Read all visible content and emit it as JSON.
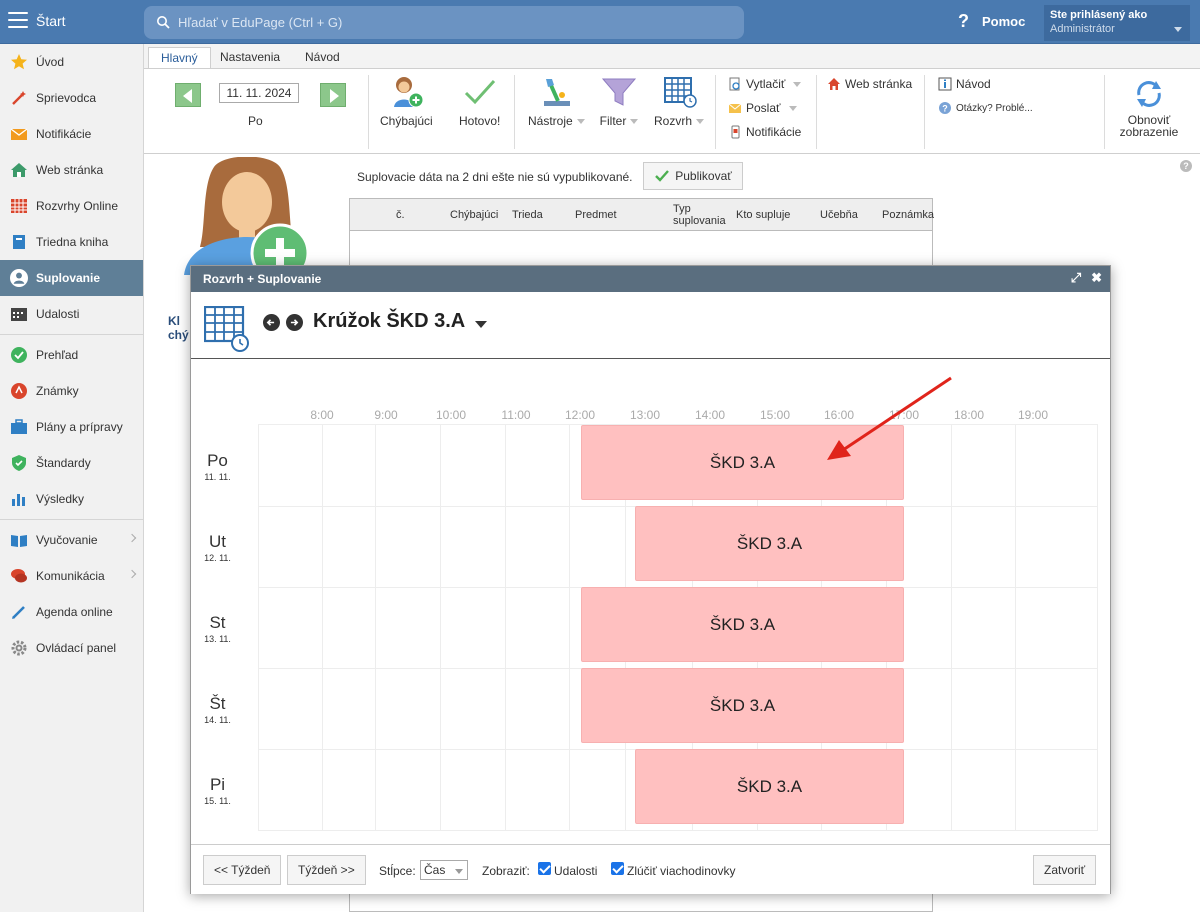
{
  "topbar": {
    "start_label": "Štart",
    "search_placeholder": "Hľadať v EduPage (Ctrl + G)",
    "help_label": "Pomoc",
    "user_line1": "Ste prihlásený ako",
    "user_line2": "Administrátor"
  },
  "sidebar": {
    "items": [
      {
        "label": "Úvod",
        "icon": "star-icon"
      },
      {
        "label": "Sprievodca",
        "icon": "magic-wand-icon"
      },
      {
        "label": "Notifikácie",
        "icon": "envelope-icon"
      },
      {
        "label": "Web stránka",
        "icon": "house-icon"
      },
      {
        "label": "Rozvrhy Online",
        "icon": "calendar-grid-icon"
      },
      {
        "label": "Triedna kniha",
        "icon": "book-icon"
      },
      {
        "label": "Suplovanie",
        "icon": "person-icon"
      },
      {
        "label": "Udalosti",
        "icon": "calendar-icon"
      },
      {
        "label": "Prehľad",
        "icon": "check-circle-icon"
      },
      {
        "label": "Známky",
        "icon": "grade-icon"
      },
      {
        "label": "Plány a prípravy",
        "icon": "briefcase-icon"
      },
      {
        "label": "Štandardy",
        "icon": "shield-check-icon"
      },
      {
        "label": "Výsledky",
        "icon": "bar-chart-icon"
      },
      {
        "label": "Vyučovanie",
        "icon": "open-book-icon"
      },
      {
        "label": "Komunikácia",
        "icon": "chat-icon"
      },
      {
        "label": "Agenda online",
        "icon": "pen-icon"
      },
      {
        "label": "Ovládací panel",
        "icon": "gear-icon"
      }
    ],
    "active": "Suplovanie"
  },
  "tabs": [
    "Hlavný",
    "Nastavenia",
    "Návod"
  ],
  "ribbon": {
    "date": "11. 11. 2024",
    "day": "Po",
    "absent_label": "Chýbajúci",
    "done_label": "Hotovo!",
    "tools_label": "Nástroje",
    "filter_label": "Filter",
    "timetable_label": "Rozvrh",
    "print_label": "Vytlačiť",
    "send_label": "Poslať",
    "notifications_label": "Notifikácie",
    "web_label": "Web stránka",
    "guide_label": "Návod",
    "questions_label": "Otázky? Problé...",
    "refresh_label_1": "Obnoviť",
    "refresh_label_2": "zobrazenie"
  },
  "main": {
    "publish_note": "Suplovacie dáta na 2 dni ešte nie sú vypublikované.",
    "publish_button": "Publikovať",
    "kl_text_1": "Kl",
    "kl_text_2": "chý",
    "table_headers": [
      "č.",
      "Chýbajúci",
      "Trieda",
      "Predmet",
      "Typ",
      "suplovania",
      "Kto supluje",
      "Učebňa",
      "Poznámka"
    ]
  },
  "modal": {
    "title": "Rozvrh + Suplovanie",
    "name": "Krúžok ŠKD 3.A",
    "hours": [
      "8:00",
      "9:00",
      "10:00",
      "11:00",
      "12:00",
      "13:00",
      "14:00",
      "15:00",
      "16:00",
      "17:00",
      "18:00",
      "19:00"
    ],
    "days": [
      {
        "name": "Po",
        "date": "11. 11.",
        "lesson": "ŠKD 3.A"
      },
      {
        "name": "Ut",
        "date": "12. 11.",
        "lesson": "ŠKD 3.A"
      },
      {
        "name": "St",
        "date": "13. 11.",
        "lesson": "ŠKD 3.A"
      },
      {
        "name": "Št",
        "date": "14. 11.",
        "lesson": "ŠKD 3.A"
      },
      {
        "name": "Pi",
        "date": "15. 11.",
        "lesson": "ŠKD 3.A"
      }
    ],
    "footer": {
      "prev_week": "<< Týždeň",
      "next_week": "Týždeň >>",
      "columns_label": "Stĺpce:",
      "columns_value": "Čas",
      "show_label": "Zobraziť:",
      "events_label": "Udalosti",
      "merge_label": "Zlúčiť viachodinovky",
      "close_label": "Zatvoriť"
    }
  },
  "colors": {
    "topbar": "#4a7ab0",
    "sidebar_active": "#5f7f97",
    "lesson": "#ffc0c0",
    "annotation_arrow": "#e0241b"
  }
}
